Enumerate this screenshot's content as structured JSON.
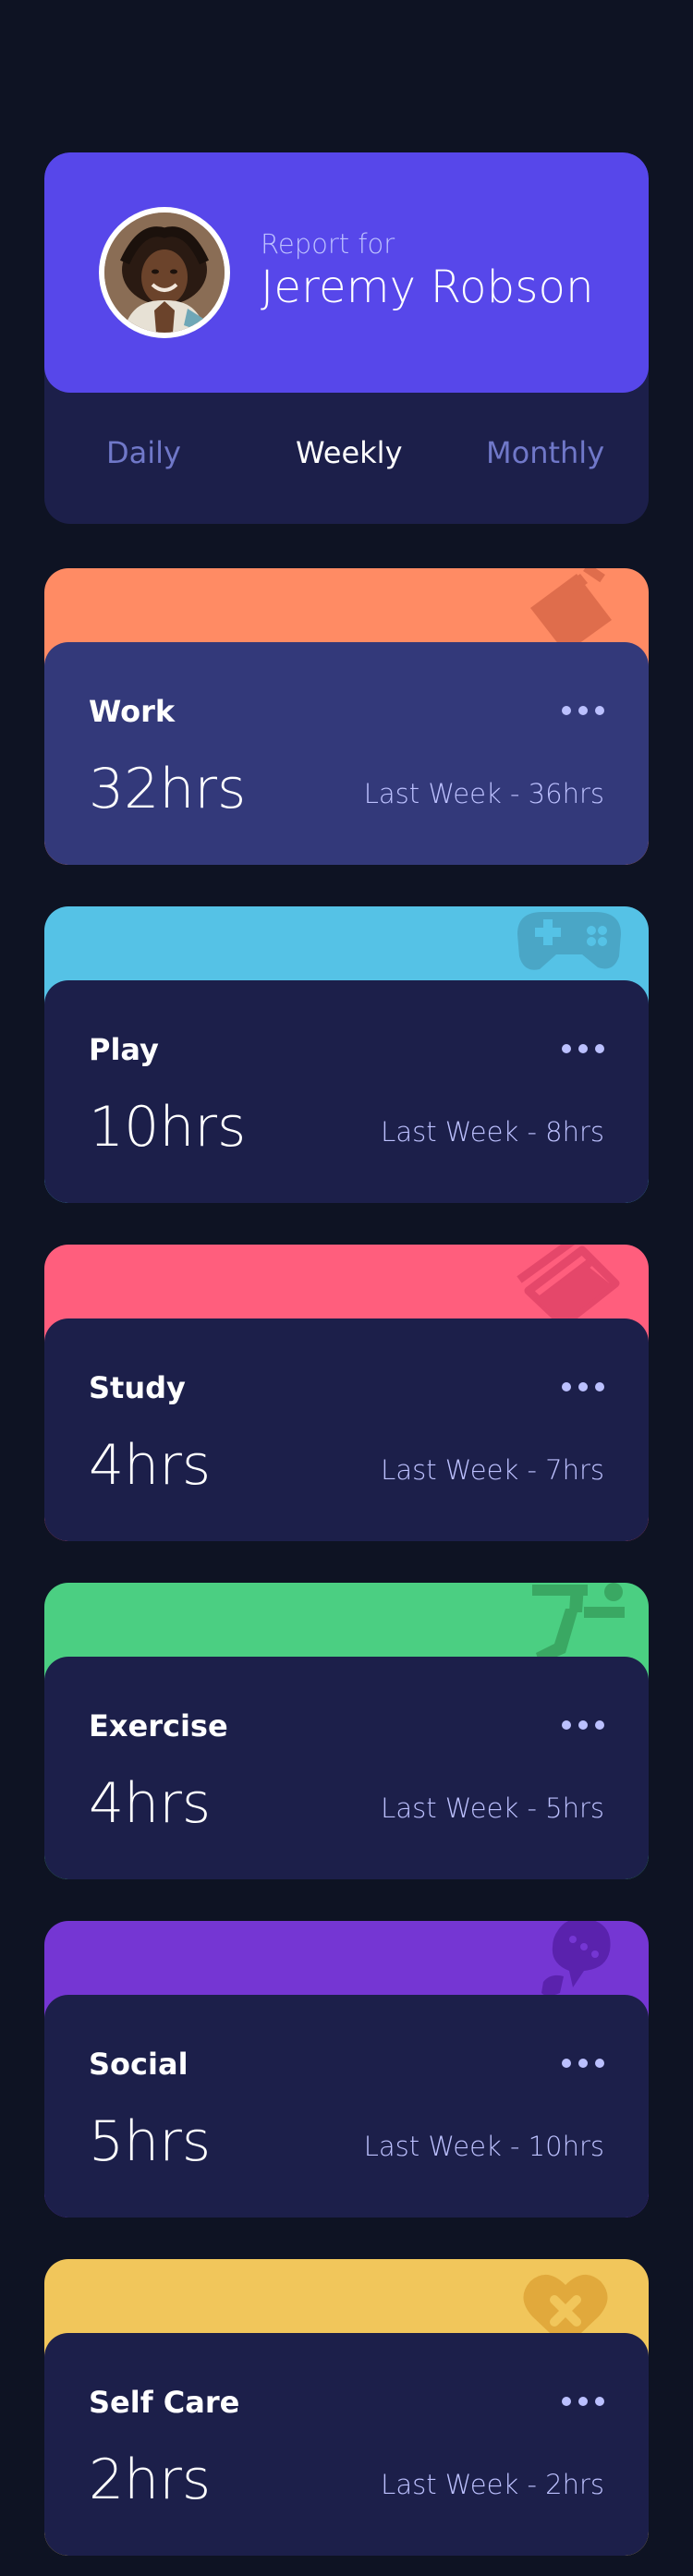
{
  "profile": {
    "report_label": "Report for",
    "name": "Jeremy Robson",
    "avatar_icon": "user-avatar"
  },
  "tabs": [
    {
      "label": "Daily",
      "active": false
    },
    {
      "label": "Weekly",
      "active": true
    },
    {
      "label": "Monthly",
      "active": false
    }
  ],
  "activities": [
    {
      "title": "Work",
      "hours": "32hrs",
      "previous": "Last Week - 36hrs",
      "color": "#ff8b64",
      "icon": "briefcase-icon"
    },
    {
      "title": "Play",
      "hours": "10hrs",
      "previous": "Last Week - 8hrs",
      "color": "#55c2e6",
      "icon": "gamepad-icon"
    },
    {
      "title": "Study",
      "hours": "4hrs",
      "previous": "Last Week - 7hrs",
      "color": "#ff5e7d",
      "icon": "book-icon"
    },
    {
      "title": "Exercise",
      "hours": "4hrs",
      "previous": "Last Week - 5hrs",
      "color": "#4bcf82",
      "icon": "running-icon"
    },
    {
      "title": "Social",
      "hours": "5hrs",
      "previous": "Last Week - 10hrs",
      "color": "#7536d3",
      "icon": "chat-icon"
    },
    {
      "title": "Self Care",
      "hours": "2hrs",
      "previous": "Last Week - 2hrs",
      "color": "#f1c65b",
      "icon": "heart-icon"
    }
  ],
  "colors": {
    "page_bg": "#0e1323",
    "card_bg": "#1c1f4a",
    "accent": "#5747ea",
    "muted": "#7078c9",
    "soft": "#bdc1ff"
  }
}
